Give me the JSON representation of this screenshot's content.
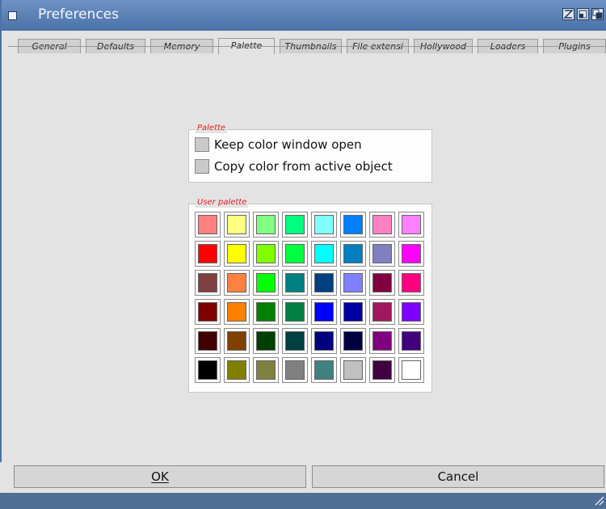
{
  "window": {
    "title": "Preferences",
    "icons": [
      "close-icon",
      "zoom-icon",
      "iconify-icon",
      "depth-icon"
    ]
  },
  "tabs": [
    {
      "label": "General",
      "active": false
    },
    {
      "label": "Defaults",
      "active": false
    },
    {
      "label": "Memory",
      "active": false
    },
    {
      "label": "Palette",
      "active": true
    },
    {
      "label": "Thumbnails",
      "active": false
    },
    {
      "label": "File extensi",
      "active": false
    },
    {
      "label": "Hollywood",
      "active": false
    },
    {
      "label": "Loaders",
      "active": false
    },
    {
      "label": "Plugins",
      "active": false
    }
  ],
  "palette_group": {
    "label": "Palette",
    "options": [
      {
        "label": "Keep color window open",
        "checked": false
      },
      {
        "label": "Copy color from active object",
        "checked": false
      }
    ]
  },
  "user_palette": {
    "label": "User palette",
    "colors": [
      [
        "#ff8080",
        "#ffff80",
        "#80ff80",
        "#00ff80",
        "#80ffff",
        "#0080ff",
        "#ff80c0",
        "#ff80ff"
      ],
      [
        "#ff0000",
        "#ffff00",
        "#80ff00",
        "#00ff40",
        "#00ffff",
        "#0080c0",
        "#8080c0",
        "#ff00ff"
      ],
      [
        "#804040",
        "#ff8040",
        "#00ff00",
        "#008080",
        "#004080",
        "#8080ff",
        "#800040",
        "#ff0080"
      ],
      [
        "#800000",
        "#ff8000",
        "#008000",
        "#008040",
        "#0000ff",
        "#0000a0",
        "#a01860",
        "#8000ff"
      ],
      [
        "#400000",
        "#804000",
        "#004000",
        "#004040",
        "#000080",
        "#000040",
        "#800080",
        "#400080"
      ],
      [
        "#000000",
        "#808000",
        "#808040",
        "#808080",
        "#408080",
        "#c0c0c0",
        "#400040",
        "#ffffff"
      ]
    ]
  },
  "buttons": {
    "ok": {
      "label": "OK"
    },
    "cancel": {
      "label": "Cancel"
    }
  },
  "colors": {
    "titlebar": "#4a72a8",
    "background": "#e3e3e3",
    "group_label": "#e02020"
  }
}
